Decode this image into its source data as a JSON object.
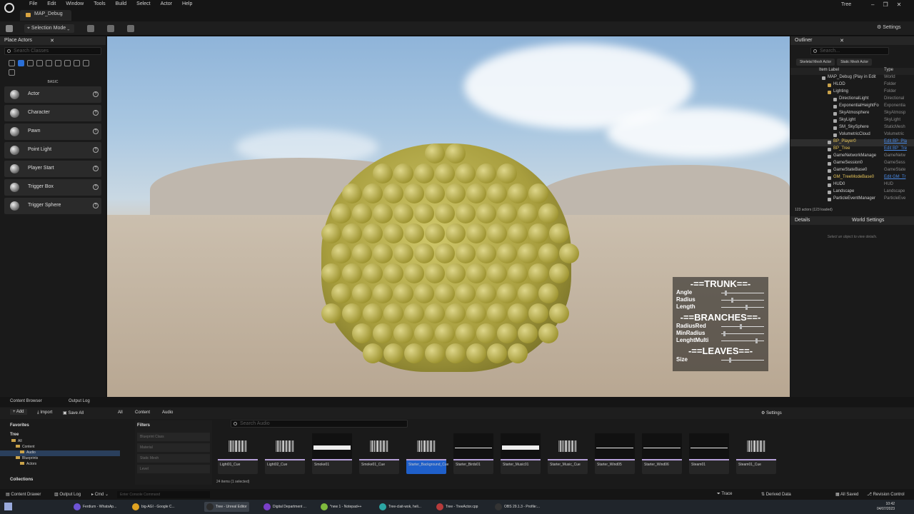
{
  "menubar": {
    "items": [
      "File",
      "Edit",
      "Window",
      "Tools",
      "Build",
      "Select",
      "Actor",
      "Help"
    ],
    "map_tab": "MAP_Debug",
    "project": "Tree"
  },
  "toolbar": {
    "selection_mode": "Selection Mode",
    "settings": "Settings"
  },
  "place_actors": {
    "title": "Place Actors",
    "search_placeholder": "Search Classes",
    "category": "BASIC",
    "actors": [
      "Actor",
      "Character",
      "Pawn",
      "Point Light",
      "Player Start",
      "Trigger Box",
      "Trigger Sphere"
    ]
  },
  "tree_ui": {
    "trunk_header": "-==TRUNK==-",
    "trunk_rows": [
      {
        "label": "Angle",
        "value": 0.08
      },
      {
        "label": "Radius",
        "value": 0.25
      },
      {
        "label": "Length",
        "value": 0.6
      }
    ],
    "branches_header": "-==BRANCHES==-",
    "branches_rows": [
      {
        "label": "RadiusRed",
        "value": 0.45
      },
      {
        "label": "MinRadius",
        "value": 0.05
      },
      {
        "label": "LenghtMulti",
        "value": 0.85
      }
    ],
    "leaves_header": "-==LEAVES==-",
    "leaves_rows": [
      {
        "label": "Size",
        "value": 0.2
      }
    ]
  },
  "outliner": {
    "title": "Outliner",
    "search_placeholder": "Search...",
    "filters": [
      "Skeletal Mesh Actor",
      "Static Mesh Actor"
    ],
    "col_label": "Item Label",
    "col_type": "Type",
    "rows": [
      {
        "label": "MAP_Debug (Play in Edit",
        "type": "World",
        "indent": 0
      },
      {
        "label": "HLOD",
        "type": "Folder",
        "indent": 1
      },
      {
        "label": "Lighting",
        "type": "Folder",
        "indent": 1
      },
      {
        "label": "DirectionalLight",
        "type": "Directional",
        "indent": 2
      },
      {
        "label": "ExponentialHeightFo",
        "type": "Exponentia",
        "indent": 2
      },
      {
        "label": "SkyAtmosphere",
        "type": "SkyAtmosp",
        "indent": 2
      },
      {
        "label": "SkyLight",
        "type": "SkyLight",
        "indent": 2
      },
      {
        "label": "SM_SkySphere",
        "type": "StaticMesh",
        "indent": 2
      },
      {
        "label": "VolumetricCloud",
        "type": "Volumetric",
        "indent": 2
      },
      {
        "label": "BP_Player0",
        "type": "Edit BP_Pla",
        "indent": 1,
        "highlight": true
      },
      {
        "label": "BP_Tree",
        "type": "Edit BP_Tre",
        "indent": 1
      },
      {
        "label": "GameNetworkManage",
        "type": "GameNetw",
        "indent": 1
      },
      {
        "label": "GameSession0",
        "type": "GameSess",
        "indent": 1
      },
      {
        "label": "GameStateBase0",
        "type": "GameState",
        "indent": 1
      },
      {
        "label": "GM_TreeModeBase0",
        "type": "Edit GM_Tr",
        "indent": 1
      },
      {
        "label": "HUD0",
        "type": "HUD",
        "indent": 1
      },
      {
        "label": "Landscape",
        "type": "Landscape",
        "indent": 1
      },
      {
        "label": "ParticleEventManager",
        "type": "ParticleEve",
        "indent": 1
      }
    ],
    "count": "123 actors (123 loaded)"
  },
  "details": {
    "tab": "Details",
    "world_settings": "World Settings",
    "empty": "Select an object to view details."
  },
  "content_browser": {
    "tab": "Content Browser",
    "output_tab": "Output Log",
    "add": "Add",
    "import": "Import",
    "save_all": "Save All",
    "path": [
      "All",
      "Content",
      "Audio"
    ],
    "settings": "Settings",
    "favorites": "Favorites",
    "root": "Tree",
    "tree": [
      "All",
      "Content",
      "Audio",
      "Blueprints",
      "Actors"
    ],
    "collections": "Collections",
    "filters_title": "Filters",
    "filter_items": [
      "Blueprint Class",
      "Material",
      "Static Mesh",
      "Level"
    ],
    "search_placeholder": "Search Audio",
    "assets": [
      {
        "name": "Light01_Cue",
        "kind": "wave"
      },
      {
        "name": "Light02_Cue",
        "kind": "wave"
      },
      {
        "name": "Smoke01",
        "kind": "noise"
      },
      {
        "name": "Smoke01_Cue",
        "kind": "wave"
      },
      {
        "name": "Starter_Background_Cue",
        "kind": "wave",
        "selected": true
      },
      {
        "name": "Starter_Birds01",
        "kind": "line"
      },
      {
        "name": "Starter_Music01",
        "kind": "noise"
      },
      {
        "name": "Starter_Music_Cue",
        "kind": "wave"
      },
      {
        "name": "Starter_Wind05",
        "kind": "line"
      },
      {
        "name": "Starter_Wind06",
        "kind": "line"
      },
      {
        "name": "Steam01",
        "kind": "line"
      },
      {
        "name": "Steam01_Cue",
        "kind": "wave"
      }
    ],
    "item_count": "24 items (1 selected)"
  },
  "statusbar": {
    "content_drawer": "Content Drawer",
    "output_log": "Output Log",
    "cmd": "Cmd",
    "console_placeholder": "Enter Console Command",
    "trace": "Trace",
    "derived_data": "Derived Data",
    "all_saved": "All Saved",
    "revision_control": "Revision Control"
  },
  "taskbar": {
    "apps": [
      {
        "label": "Ferdium - WhatsAp...",
        "color": "#6e54d6"
      },
      {
        "label": "big-AGI - Google C...",
        "color": "#e0a321"
      },
      {
        "label": "Tree - Unreal Editor",
        "color": "#2b2b2b",
        "active": true
      },
      {
        "label": "Digital Department ...",
        "color": "#7a3fc9"
      },
      {
        "label": "*new 1 - Notepad++",
        "color": "#7fba3d"
      },
      {
        "label": "Tree-clait-wok, heli...",
        "color": "#2ca6a4"
      },
      {
        "label": "Tree - TreeActor.cpp",
        "color": "#b73b3b"
      },
      {
        "label": "OBS 29.1.3 - Profile:...",
        "color": "#333"
      }
    ],
    "time": "10:42",
    "date": "04/07/2023"
  }
}
